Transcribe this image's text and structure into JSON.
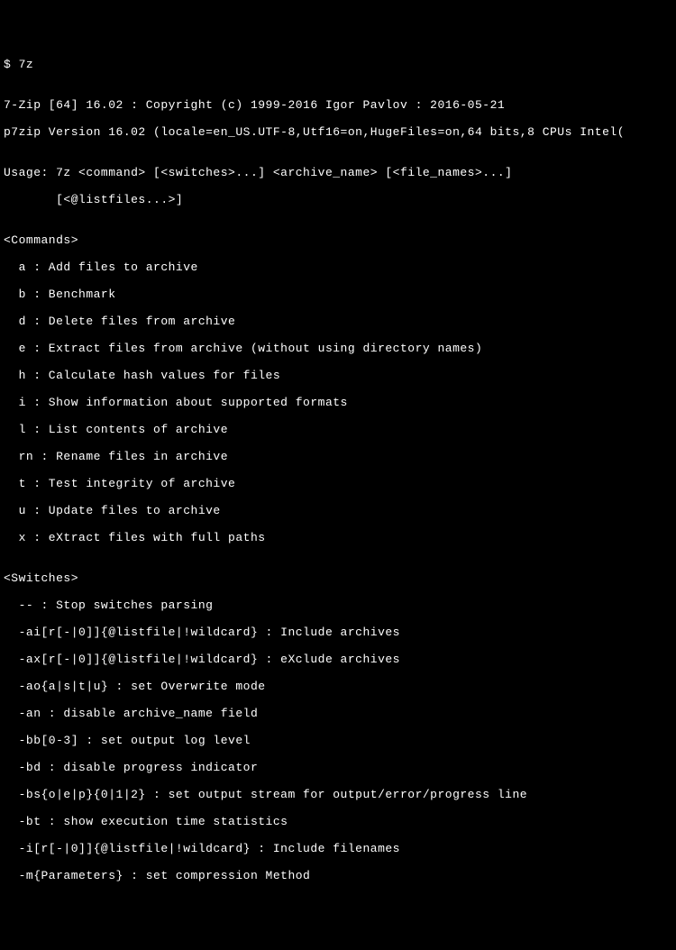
{
  "prompt": "$ 7z",
  "blank": "",
  "header1": "7-Zip [64] 16.02 : Copyright (c) 1999-2016 Igor Pavlov : 2016-05-21",
  "header2": "p7zip Version 16.02 (locale=en_US.UTF-8,Utf16=on,HugeFiles=on,64 bits,8 CPUs Intel(",
  "usage1": "Usage: 7z <command> [<switches>...] <archive_name> [<file_names>...]",
  "usage2": "       [<@listfiles...>]",
  "commandsHeader": "<Commands>",
  "cmd_a": "  a : Add files to archive",
  "cmd_b": "  b : Benchmark",
  "cmd_d": "  d : Delete files from archive",
  "cmd_e": "  e : Extract files from archive (without using directory names)",
  "cmd_h": "  h : Calculate hash values for files",
  "cmd_i": "  i : Show information about supported formats",
  "cmd_l": "  l : List contents of archive",
  "cmd_rn": "  rn : Rename files in archive",
  "cmd_t": "  t : Test integrity of archive",
  "cmd_u": "  u : Update files to archive",
  "cmd_x": "  x : eXtract files with full paths",
  "switchesHeader": "<Switches>",
  "sw_stop": "  -- : Stop switches parsing",
  "sw_ai": "  -ai[r[-|0]]{@listfile|!wildcard} : Include archives",
  "sw_ax": "  -ax[r[-|0]]{@listfile|!wildcard} : eXclude archives",
  "sw_ao": "  -ao{a|s|t|u} : set Overwrite mode",
  "sw_an": "  -an : disable archive_name field",
  "sw_bb": "  -bb[0-3] : set output log level",
  "sw_bd": "  -bd : disable progress indicator",
  "sw_bs": "  -bs{o|e|p}{0|1|2} : set output stream for output/error/progress line",
  "sw_bt": "  -bt : show execution time statistics",
  "sw_i": "  -i[r[-|0]]{@listfile|!wildcard} : Include filenames",
  "sw_m": "  -m{Parameters} : set compression Method"
}
